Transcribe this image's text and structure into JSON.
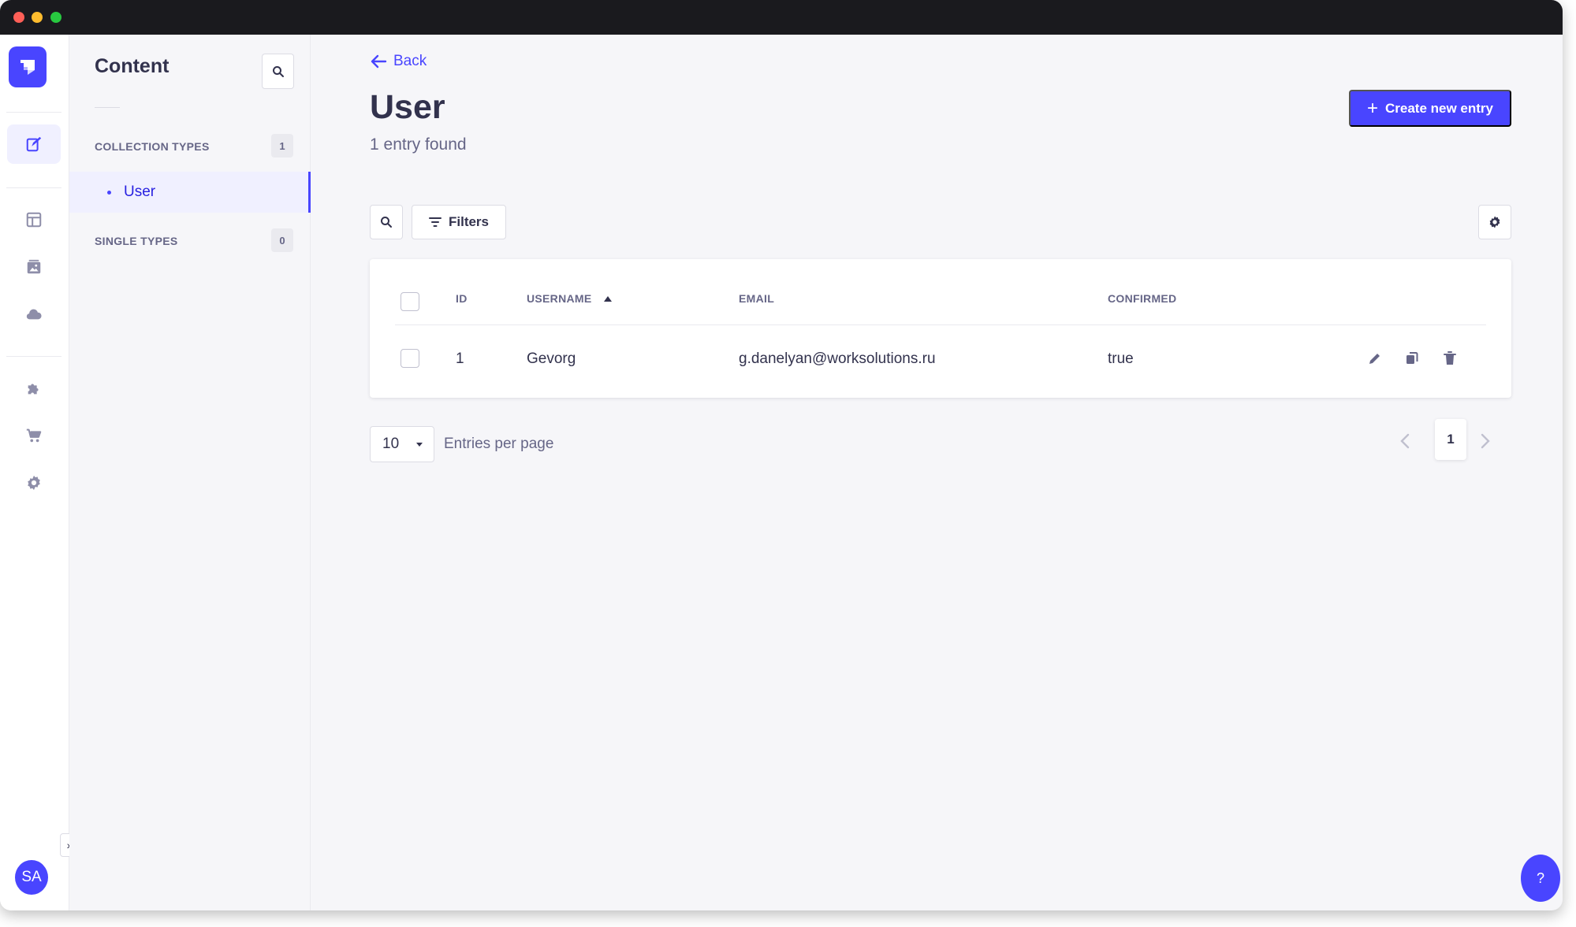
{
  "sidebar": {
    "logo_icon": "strapi-logo-icon",
    "items": [
      {
        "icon": "content-manager-icon",
        "active": true
      },
      {
        "icon": "content-type-builder-icon"
      },
      {
        "icon": "media-library-icon"
      },
      {
        "icon": "cloud-icon"
      },
      {
        "icon": "plugins-puzzle-icon"
      },
      {
        "icon": "marketplace-cart-icon"
      },
      {
        "icon": "settings-gear-icon"
      }
    ],
    "avatar_initials": "SA",
    "expand_label": "›"
  },
  "subnav": {
    "title": "Content",
    "collection_types_label": "COLLECTION TYPES",
    "collection_types_count": "1",
    "collection_items": [
      {
        "label": "User",
        "active": true
      }
    ],
    "single_types_label": "SINGLE TYPES",
    "single_types_count": "0"
  },
  "main": {
    "back_label": "Back",
    "title": "User",
    "subtitle": "1 entry found",
    "create_label": "Create new entry",
    "filters_label": "Filters",
    "table": {
      "columns": [
        "ID",
        "USERNAME",
        "EMAIL",
        "CONFIRMED"
      ],
      "sorted_column": "USERNAME",
      "sort_direction": "asc",
      "rows": [
        {
          "id": "1",
          "username": "Gevorg",
          "email": "g.danelyan@worksolutions.ru",
          "confirmed": "true"
        }
      ]
    },
    "pagination": {
      "per_page": "10",
      "per_page_label": "Entries per page",
      "current_page": "1"
    },
    "help_label": "?"
  },
  "colors": {
    "primary": "#4945ff",
    "background": "#f6f6f9",
    "text": "#32324d",
    "muted_text": "#666687"
  }
}
